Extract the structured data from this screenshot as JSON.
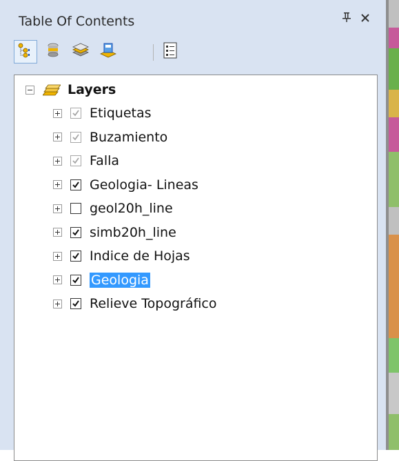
{
  "toc": {
    "title": "Table Of Contents",
    "pin_glyph": "ᴪ",
    "close_glyph": "✕",
    "toolbar": [
      {
        "name": "list-by-drawing-order-icon",
        "active": true
      },
      {
        "name": "list-by-source-icon",
        "active": false
      },
      {
        "name": "list-by-visibility-icon",
        "active": false
      },
      {
        "name": "list-by-selection-icon",
        "active": false
      },
      {
        "name": "options-icon",
        "active": false
      }
    ],
    "root": {
      "label": "Layers"
    },
    "layers": [
      {
        "label": "Etiquetas",
        "checked": true,
        "greyed": true,
        "selected": false
      },
      {
        "label": "Buzamiento",
        "checked": true,
        "greyed": true,
        "selected": false
      },
      {
        "label": "Falla",
        "checked": true,
        "greyed": true,
        "selected": false
      },
      {
        "label": "Geologia- Lineas",
        "checked": true,
        "greyed": false,
        "selected": false
      },
      {
        "label": "geol20h_line",
        "checked": false,
        "greyed": false,
        "selected": false
      },
      {
        "label": "simb20h_line",
        "checked": true,
        "greyed": false,
        "selected": false
      },
      {
        "label": "Indice de Hojas",
        "checked": true,
        "greyed": false,
        "selected": false
      },
      {
        "label": "Geologia",
        "checked": true,
        "greyed": false,
        "selected": true
      },
      {
        "label": "Relieve Topográfico",
        "checked": true,
        "greyed": false,
        "selected": false
      }
    ]
  },
  "colors": {
    "panel_bg": "#d9e3f2",
    "selection": "#3399ff",
    "check_grey": "#a6a6a6"
  }
}
